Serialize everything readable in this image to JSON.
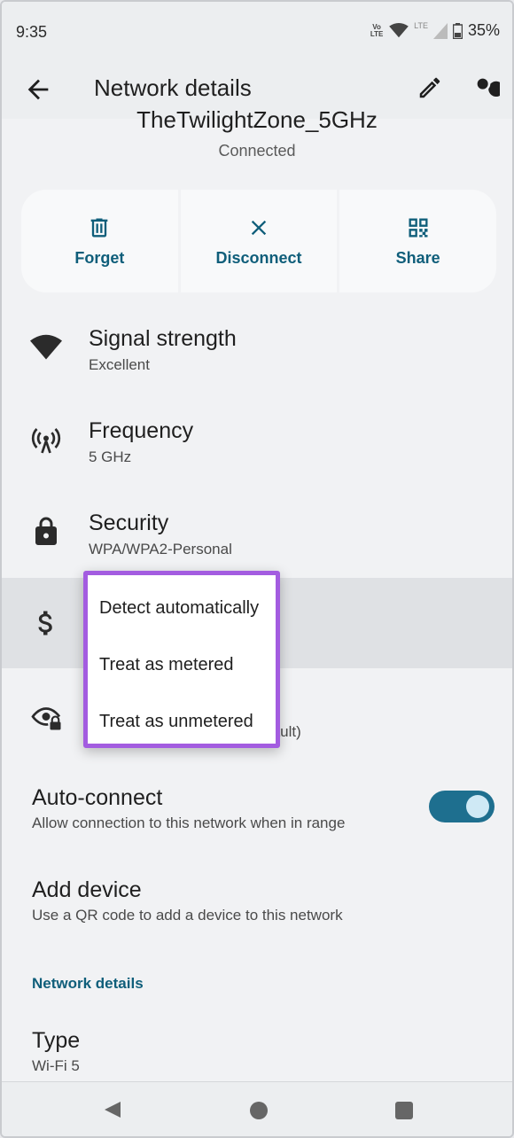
{
  "status_bar": {
    "time": "9:35",
    "volte": "Vo LTE",
    "lte": "LTE",
    "battery": "35%"
  },
  "app_bar": {
    "title": "Network details"
  },
  "network": {
    "name": "TheTwilightZone_5GHz",
    "status": "Connected"
  },
  "actions": [
    {
      "label": "Forget",
      "icon": "trash-icon"
    },
    {
      "label": "Disconnect",
      "icon": "close-icon"
    },
    {
      "label": "Share",
      "icon": "qr-code-icon"
    }
  ],
  "items": {
    "signal": {
      "title": "Signal strength",
      "value": "Excellent"
    },
    "frequency": {
      "title": "Frequency",
      "value": "5 GHz"
    },
    "security": {
      "title": "Security",
      "value": "WPA/WPA2-Personal"
    },
    "privacy": {
      "partial_value": "fault)"
    },
    "auto_connect": {
      "title": "Auto-connect",
      "value": "Allow connection to this network when in range",
      "enabled": true
    },
    "add_device": {
      "title": "Add device",
      "value": "Use a QR code to add a device to this network"
    },
    "section_header": "Network details",
    "type": {
      "title": "Type",
      "value": "Wi-Fi 5"
    }
  },
  "dropdown": {
    "options": [
      "Detect automatically",
      "Treat as metered",
      "Treat as unmetered"
    ]
  },
  "colors": {
    "accent": "#0f5e7a",
    "toggle": "#1e6f8f",
    "highlight_border": "#a35ce0"
  }
}
